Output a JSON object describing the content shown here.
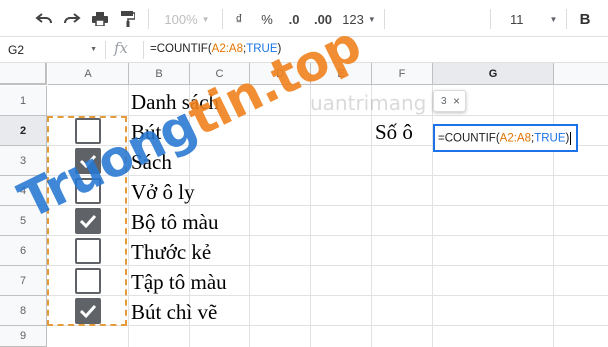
{
  "toolbar": {
    "zoom": "100%",
    "currency_symbol": "₫",
    "percent": "%",
    "decrease_decimal": ".0",
    "increase_decimal": ".00",
    "number_format": "123",
    "font_size": "11",
    "icons": [
      "undo-icon",
      "redo-icon",
      "print-icon",
      "paint-format-icon",
      "bold-icon"
    ]
  },
  "formula_bar": {
    "name_box": "G2",
    "fx": "fx",
    "formula_prefix": "=COUNTIF(",
    "formula_range": "A2:A8",
    "formula_sep": ";",
    "formula_bool": "TRUE",
    "formula_suffix": ")"
  },
  "columns": [
    "A",
    "B",
    "C",
    "D",
    "E",
    "F",
    "G"
  ],
  "rows": [
    "1",
    "2",
    "3",
    "4",
    "5",
    "6",
    "7",
    "8",
    "9"
  ],
  "cells": {
    "b1": "Danh sách",
    "b2": "Bút",
    "b3": "Sách",
    "b4": "Vở ô ly",
    "b5": "Bộ tô màu",
    "b6": "Thước kẻ",
    "b7": "Tập tô màu",
    "b8": "Bút chì vẽ",
    "f2": "Số ô"
  },
  "checkboxes": [
    false,
    true,
    false,
    true,
    false,
    false,
    true
  ],
  "tooltip": {
    "value": "3",
    "close": "×"
  },
  "watermark": {
    "brand": "Truong",
    "domain": "tin.top",
    "logo_text": "uantrimang"
  },
  "colors": {
    "range": "#e37400",
    "bool": "#1a73e8",
    "selection": "#1a73e8",
    "dashed_border": "#e49b3a",
    "checkbox": "#5f6368"
  }
}
